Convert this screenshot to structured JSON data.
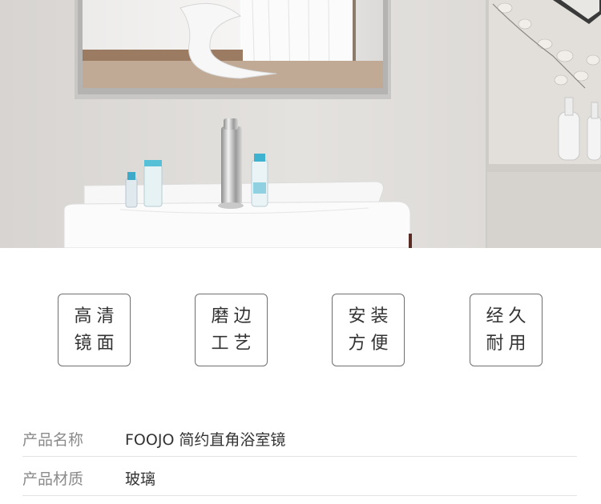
{
  "hero": {
    "alt_subject": "bathroom-mirror-scene"
  },
  "features": [
    {
      "line1": "高清",
      "line2": "镜面"
    },
    {
      "line1": "磨边",
      "line2": "工艺"
    },
    {
      "line1": "安装",
      "line2": "方便"
    },
    {
      "line1": "经久",
      "line2": "耐用"
    }
  ],
  "specs": [
    {
      "label": "产品名称",
      "value": "FOOJO 简约直角浴室镜"
    },
    {
      "label": "产品材质",
      "value": "玻璃"
    }
  ],
  "colors": {
    "wall": "#dedbd8",
    "border": "#6f6f6f",
    "label_text": "#8a8a8a",
    "value_text": "#333333"
  }
}
